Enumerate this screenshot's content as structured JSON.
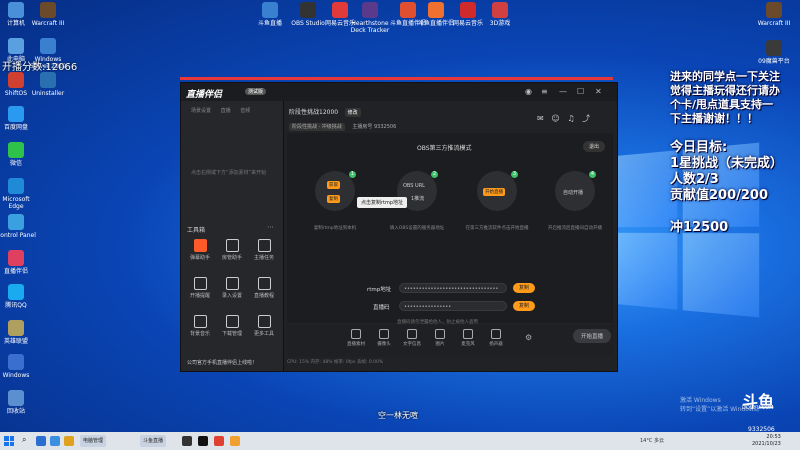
{
  "desktop_icons_left": [
    {
      "label": "计算机",
      "color": "#4a90d9"
    },
    {
      "label": "Warcraft III",
      "color": "#6a4a2a"
    },
    {
      "label": "此电脑",
      "color": "#5aa0e0"
    },
    {
      "label": "Windows Server 2012",
      "color": "#3a7fd0"
    },
    {
      "label": "ShiftOS",
      "color": "#d04030"
    },
    {
      "label": "Uninstaller",
      "color": "#2a70b0"
    },
    {
      "label": "百度网盘",
      "color": "#2a9af0"
    },
    {
      "label": "微信",
      "color": "#2ec24a"
    },
    {
      "label": "Microsoft Edge",
      "color": "#1f8ad8"
    },
    {
      "label": "Control Panel",
      "color": "#3aa0e0"
    },
    {
      "label": "直播伴侣",
      "color": "#e04060"
    },
    {
      "label": "腾讯QQ",
      "color": "#1aaaf0"
    },
    {
      "label": "英雄联盟",
      "color": "#b0a060"
    },
    {
      "label": "Windows",
      "color": "#3a6fd0"
    },
    {
      "label": "回收站",
      "color": "#5a8fd0"
    }
  ],
  "desktop_icons_top": [
    {
      "label": "斗鱼直播",
      "color": "#3a80d0"
    },
    {
      "label": "OBS Studio",
      "color": "#333333"
    },
    {
      "label": "网易云音乐",
      "color": "#e03a3a"
    },
    {
      "label": "Hearthstone Deck Tracker",
      "color": "#5a3a8a"
    },
    {
      "label": "斗鱼直播伴侣",
      "color": "#e05030"
    },
    {
      "label": "斗鱼直播伴侣",
      "color": "#f07030"
    },
    {
      "label": "网易云音乐",
      "color": "#d02a2a"
    },
    {
      "label": "3D游戏",
      "color": "#d04040"
    }
  ],
  "desktop_icons_right": [
    {
      "label": "Warcraft III",
      "color": "#6a4a2a"
    },
    {
      "label": "09魔兽平台",
      "color": "#3a3a3a"
    }
  ],
  "overlay_left": "开播分数:12066",
  "overlay_right": {
    "line1": "进来的同学点一下关注",
    "line2": "觉得主播玩得还行请办",
    "line3": "个卡/甩点道具支持一",
    "line4": "下主播谢谢！！！",
    "goal_title": "今日目标:",
    "goal1": "1星挑战（未完成）",
    "goal2": "人数2/3",
    "goal3": "贡献值200/200",
    "goal4": "冲12500"
  },
  "app": {
    "logo": "直播伴侣",
    "version": "测试版",
    "left_tabs": [
      "场景设置",
      "直播",
      "音频"
    ],
    "left_empty_text": "点击右侧或下方“添加素材”来开始",
    "tools_title": "工具箱",
    "tools": [
      {
        "label": "弹幕助手",
        "active": true
      },
      {
        "label": "房管助手",
        "active": false
      },
      {
        "label": "主播任务",
        "active": false
      },
      {
        "label": "开播提醒",
        "active": false
      },
      {
        "label": "录入设置",
        "active": false
      },
      {
        "label": "直播教程",
        "active": false
      },
      {
        "label": "背景音乐",
        "active": false
      },
      {
        "label": "下载管理",
        "active": false
      },
      {
        "label": "更多工具",
        "active": false
      }
    ],
    "left_bottom_text": "公司官方手机直播伴侣上线啦！",
    "room_name": "阶段性挑战12000",
    "room_edit": "修改",
    "room_tag": "阶段性挑战 · 冲级挑战",
    "room_id_label": "主播房号",
    "room_id": "9332506",
    "stage_title": "OBS第三方推流模式",
    "exit_label": "退出",
    "steps": [
      {
        "num": "1",
        "chip1": "获取",
        "chip2": "复制",
        "caption": "复制rtmp地址到本机"
      },
      {
        "num": "2",
        "label": "OBS URL",
        "sublabel": "1推流",
        "caption": "填入OBS设置的服务器地址"
      },
      {
        "num": "3",
        "chip1": "开始直播",
        "caption": "在第三方推流软件点击开始直播"
      },
      {
        "num": "4",
        "label": "自动开播",
        "caption": "开启推流后直播间自动开播"
      }
    ],
    "tooltip": "点击复制rtmp地址",
    "rtmp_label": "rtmp地址",
    "rtmp_value": "••••••••••••••••••••••••••••••••",
    "key_label": "直播码",
    "key_value": "••••••••••••••••",
    "copy_label": "复制",
    "field_hint": "直播码请勿泄露给他人，防止被他人盗用",
    "bottom_items": [
      "直播素材",
      "摄像头",
      "文字信息",
      "图片",
      "麦克风",
      "扬声器"
    ],
    "start_label": "开始直播",
    "status_bar": "CPU: 15%    内存: 48%    帧率: 0fps    丢帧: 0.00%"
  },
  "subtitle": "空一林无喧",
  "watermark_line1": "激活 Windows",
  "watermark_line2": "转到“设置”以激活 Windows。",
  "douyu_logo": "斗鱼",
  "douyu_sub": "DOUYU.COM",
  "room_number": "9332506",
  "taskbar": {
    "apps": [
      "电脑管理",
      "斗鱼直播"
    ],
    "weather": "14°C 多云",
    "clock_time": "20:53",
    "clock_date": "2021/10/23"
  }
}
